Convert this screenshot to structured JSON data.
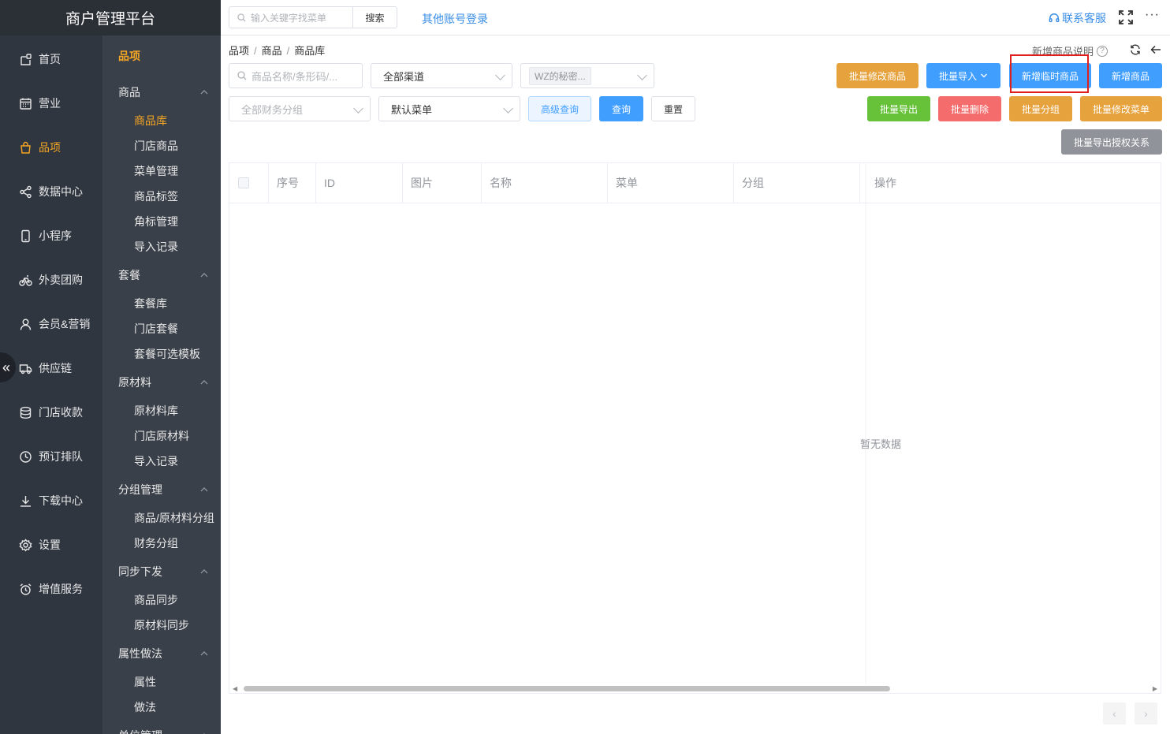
{
  "brand": "商户管理平台",
  "nav": [
    {
      "label": "首页",
      "icon": "home-icon",
      "active": false
    },
    {
      "label": "营业",
      "icon": "calendar-icon",
      "active": false
    },
    {
      "label": "品项",
      "icon": "bag-icon",
      "active": true
    },
    {
      "label": "数据中心",
      "icon": "share-icon",
      "active": false
    },
    {
      "label": "小程序",
      "icon": "phone-icon",
      "active": false
    },
    {
      "label": "外卖团购",
      "icon": "bike-icon",
      "active": false
    },
    {
      "label": "会员&营销",
      "icon": "user-icon",
      "active": false
    },
    {
      "label": "供应链",
      "icon": "truck-icon",
      "active": false
    },
    {
      "label": "门店收款",
      "icon": "coins-icon",
      "active": false
    },
    {
      "label": "预订排队",
      "icon": "clock-icon",
      "active": false
    },
    {
      "label": "下载中心",
      "icon": "download-icon",
      "active": false
    },
    {
      "label": "设置",
      "icon": "gear-icon",
      "active": false
    },
    {
      "label": "增值服务",
      "icon": "alarm-icon",
      "active": false
    }
  ],
  "subnav": {
    "title": "品项",
    "groups": [
      {
        "label": "商品",
        "items": [
          {
            "label": "商品库",
            "active": true
          },
          {
            "label": "门店商品"
          },
          {
            "label": "菜单管理"
          },
          {
            "label": "商品标签"
          },
          {
            "label": "角标管理"
          },
          {
            "label": "导入记录"
          }
        ]
      },
      {
        "label": "套餐",
        "items": [
          {
            "label": "套餐库"
          },
          {
            "label": "门店套餐"
          },
          {
            "label": "套餐可选模板"
          }
        ]
      },
      {
        "label": "原材料",
        "items": [
          {
            "label": "原材料库"
          },
          {
            "label": "门店原材料"
          },
          {
            "label": "导入记录"
          }
        ]
      },
      {
        "label": "分组管理",
        "items": [
          {
            "label": "商品/原材料分组"
          },
          {
            "label": "财务分组"
          }
        ]
      },
      {
        "label": "同步下发",
        "items": [
          {
            "label": "商品同步"
          },
          {
            "label": "原材料同步"
          }
        ]
      },
      {
        "label": "属性做法",
        "items": [
          {
            "label": "属性"
          },
          {
            "label": "做法"
          }
        ]
      },
      {
        "label": "单位管理",
        "items": []
      }
    ]
  },
  "topbar": {
    "search_placeholder": "输入关键字找菜单",
    "search_button": "搜索",
    "other_login": "其他账号登录",
    "contact": "联系客服",
    "more": "···"
  },
  "breadcrumb": [
    "品项",
    "商品",
    "商品库"
  ],
  "help_link": "新增商品说明",
  "filters": {
    "keyword_placeholder": "商品名称/条形码/...",
    "channel": "全部渠道",
    "brand_tag": "WZ的秘密...",
    "finance_group_placeholder": "全部财务分组",
    "menu": "默认菜单"
  },
  "buttons": {
    "advanced": "高级查询",
    "query": "查询",
    "reset": "重置",
    "batch_edit_goods": "批量修改商品",
    "batch_import": "批量导入",
    "add_temp_goods": "新增临时商品",
    "add_goods": "新增商品",
    "batch_export": "批量导出",
    "batch_delete": "批量删除",
    "batch_group": "批量分组",
    "batch_edit_menu": "批量修改菜单",
    "batch_export_auth": "批量导出授权关系"
  },
  "table": {
    "columns": [
      "序号",
      "ID",
      "图片",
      "名称",
      "菜单",
      "分组",
      "操作"
    ],
    "empty_text": "暂无数据"
  },
  "pager": {
    "prev": "‹",
    "next": "›"
  },
  "colors": {
    "sidebar": "#2f3640",
    "subnav": "#3a4049",
    "accent": "#f5a623",
    "primary": "#409eff",
    "warning": "#e6a23c",
    "success": "#67c23a",
    "danger": "#f56c6c",
    "info": "#909399",
    "highlight": "#e02020"
  }
}
